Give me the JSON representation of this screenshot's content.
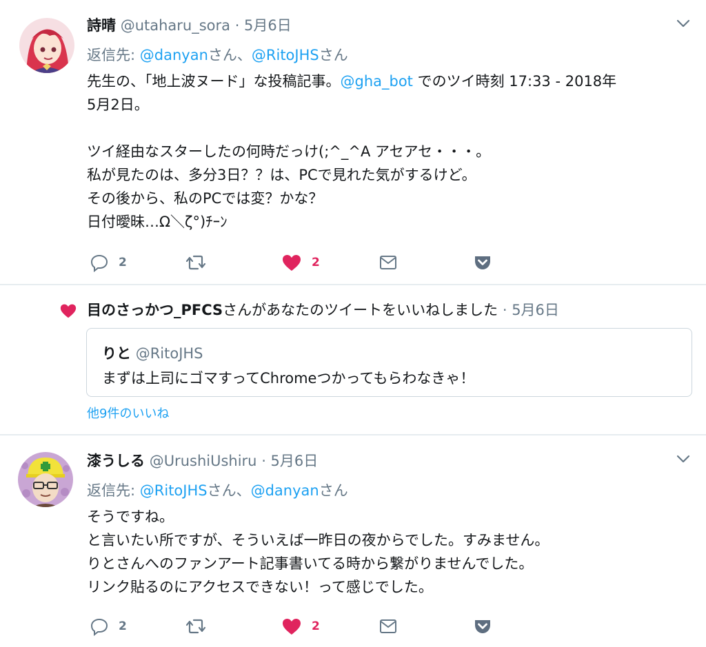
{
  "tweet1": {
    "name": "詩晴",
    "handle": "@utaharu_sora",
    "time": "· 5月6日",
    "reply_label": "返信先:",
    "reply_mention1": "@danyan",
    "reply_sep": "さん、",
    "reply_mention2": "@RitoJHS",
    "reply_suffix": "さん",
    "line1_a": "先生の、「地上波ヌード」な投稿記事。",
    "line1_mention": "@gha_bot",
    "line1_b": " でのツイ時刻 17:33 - 2018年",
    "line2": "5月2日。",
    "line3": "ツイ経由なスターしたの何時だっけ(;^_^A アセアセ・・・。",
    "line4": "私が見たのは、多分3日？？は、PCで見れた気がするけど。",
    "line5": "その後から、私のPCでは変？かな？",
    "line6": "日付曖昧…Ω＼ζ°)ﾁｰﾝ",
    "reply_count": "2",
    "like_count": "2"
  },
  "notification": {
    "user": "目のさっかつ_PFCS",
    "action": "さんがあなたのツイートをいいねしました",
    "time": " · 5月6日",
    "quote_name": "りと",
    "quote_handle": "@RitoJHS",
    "quote_text": "まずは上司にゴマすってChromeつかってもらわなきゃ！",
    "more_likes": "他9件のいいね"
  },
  "tweet2": {
    "name": "漆うしる",
    "handle": "@UrushiUshiru",
    "time": "· 5月6日",
    "reply_label": "返信先:",
    "reply_mention1": "@RitoJHS",
    "reply_sep": "さん、",
    "reply_mention2": "@danyan",
    "reply_suffix": "さん",
    "line1": "そうですね。",
    "line2": "と言いたい所ですが、そういえば一昨日の夜からでした。すみません。",
    "line3": "りとさんへのファンアート記事書いてる時から繋がりませんでした。",
    "line4": "リンク貼るのにアクセスできない！って感じでした。",
    "reply_count": "2",
    "like_count": "2"
  },
  "colors": {
    "link": "#1da1f2",
    "like": "#e0245e",
    "muted": "#657786",
    "border": "#e6ecf0"
  },
  "icons": [
    "reply-icon",
    "retweet-icon",
    "heart-icon",
    "dm-icon",
    "pocket-icon",
    "chevron-down-icon"
  ]
}
